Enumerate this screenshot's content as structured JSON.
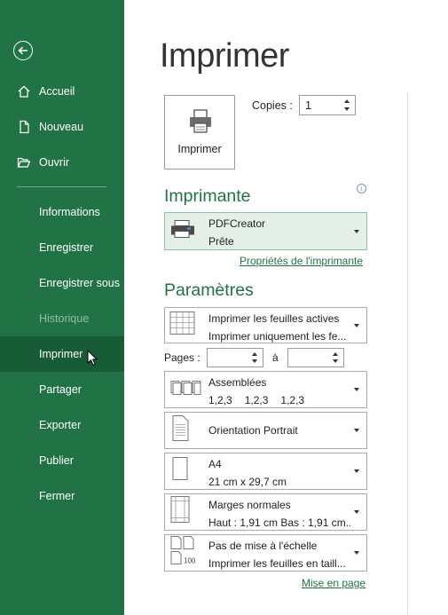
{
  "sidebar": {
    "items": [
      {
        "label": "Accueil",
        "icon": "home-icon"
      },
      {
        "label": "Nouveau",
        "icon": "new-document-icon"
      },
      {
        "label": "Ouvrir",
        "icon": "open-folder-icon"
      },
      {
        "label": "Informations"
      },
      {
        "label": "Enregistrer"
      },
      {
        "label": "Enregistrer sous"
      },
      {
        "label": "Historique",
        "state": "disabled"
      },
      {
        "label": "Imprimer",
        "state": "active"
      },
      {
        "label": "Partager"
      },
      {
        "label": "Exporter"
      },
      {
        "label": "Publier"
      },
      {
        "label": "Fermer"
      }
    ]
  },
  "main": {
    "title": "Imprimer",
    "print_button": "Imprimer",
    "copies_label": "Copies :",
    "copies_value": "1",
    "printer_section": "Imprimante",
    "printer": {
      "name": "PDFCreator",
      "status": "Prête"
    },
    "printer_properties_link": "Propriétés de l'imprimante",
    "settings_section": "Paramètres",
    "what_to_print": {
      "line1": "Imprimer les feuilles actives",
      "line2": "Imprimer uniquement les fe..."
    },
    "pages_label": "Pages :",
    "pages_to_label": "à",
    "pages_from": "",
    "pages_to": "",
    "collation": {
      "line1": "Assemblées",
      "seq": [
        "1,2,3",
        "1,2,3",
        "1,2,3"
      ]
    },
    "orientation": "Orientation Portrait",
    "paper": {
      "line1": "A4",
      "line2": "21 cm x 29,7 cm"
    },
    "margins": {
      "line1": "Marges normales",
      "line2": "Haut : 1,91 cm Bas : 1,91 cm..."
    },
    "scaling": {
      "line1": "Pas de mise à l'échelle",
      "line2": "Imprimer les feuilles en taill..."
    },
    "page_setup_link": "Mise en page"
  },
  "colors": {
    "accent": "#217346",
    "sidebar_active": "#185c37"
  }
}
